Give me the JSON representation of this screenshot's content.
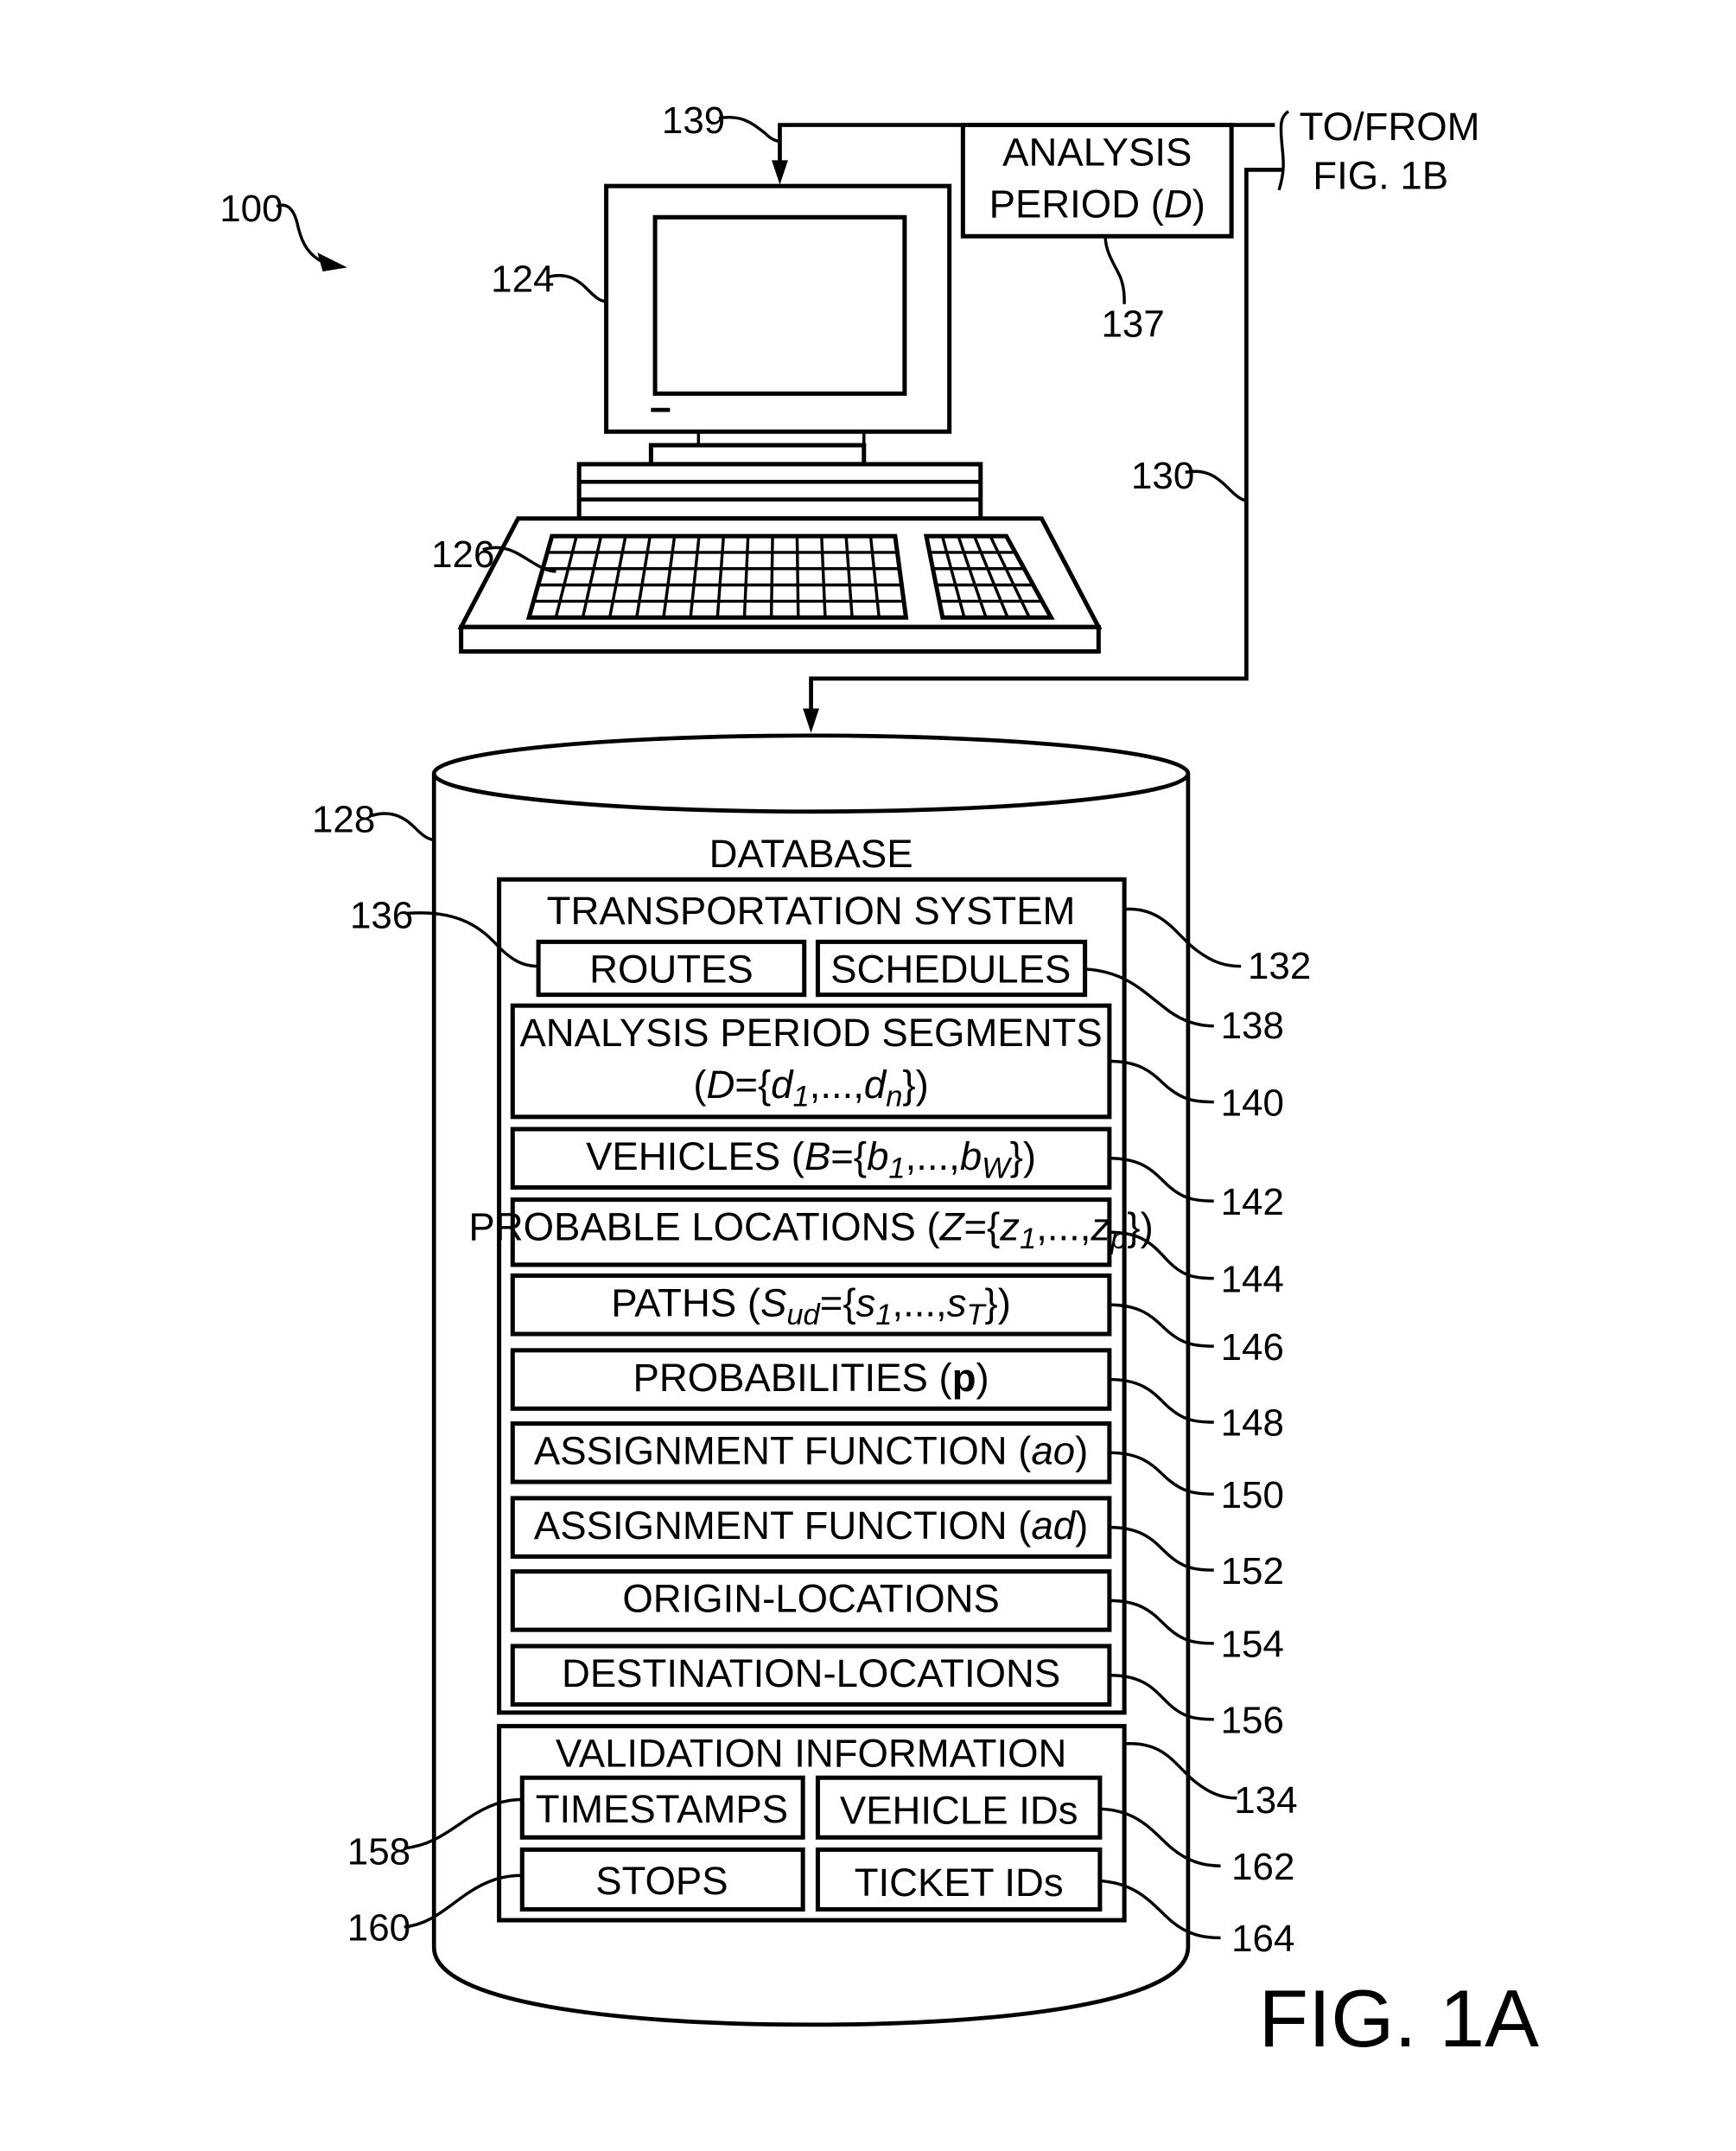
{
  "figure_label": "FIG. 1A",
  "system_ref": "100",
  "computer": {
    "monitor_ref": "124",
    "keyboard_ref": "126"
  },
  "analysis_period": {
    "ref": "137",
    "line1": "ANALYSIS",
    "line2_prefix": "PERIOD (",
    "line2_var": "D",
    "line2_suffix": ")"
  },
  "connections": {
    "input_line_ref": "139",
    "database_line_ref": "130",
    "offpage_line1": "TO/FROM",
    "offpage_line2": "FIG. 1B"
  },
  "database": {
    "ref": "128",
    "title": "DATABASE",
    "transportation_system": {
      "ref": "132",
      "title": "TRANSPORTATION SYSTEM",
      "routes": {
        "ref": "136",
        "label": "ROUTES"
      },
      "schedules": {
        "ref": "138",
        "label": "SCHEDULES"
      },
      "items": [
        {
          "ref": "140",
          "label": "ANALYSIS PERIOD SEGMENTS",
          "formula": "(D={d1,...,dn})"
        },
        {
          "ref": "142",
          "label": "VEHICLES",
          "formula": "(B={b1,...,bW})"
        },
        {
          "ref": "144",
          "label": "PROBABLE LOCATIONS",
          "formula": "(Z={z1,...,zp})"
        },
        {
          "ref": "146",
          "label": "PATHS",
          "formula": "(Sud={s1,...,sT})"
        },
        {
          "ref": "148",
          "label": "PROBABILITIES",
          "formula": "(p)"
        },
        {
          "ref": "150",
          "label": "ASSIGNMENT FUNCTION",
          "formula": "(ao)"
        },
        {
          "ref": "152",
          "label": "ASSIGNMENT FUNCTION",
          "formula": "(ad)"
        },
        {
          "ref": "154",
          "label": "ORIGIN-LOCATIONS",
          "formula": ""
        },
        {
          "ref": "156",
          "label": "DESTINATION-LOCATIONS",
          "formula": ""
        }
      ]
    },
    "validation_information": {
      "ref": "134",
      "title": "VALIDATION INFORMATION",
      "timestamps": {
        "ref": "158",
        "label": "TIMESTAMPS"
      },
      "vehicle_ids": {
        "ref": "162",
        "label": "VEHICLE IDs"
      },
      "stops": {
        "ref": "160",
        "label": "STOPS"
      },
      "ticket_ids": {
        "ref": "164",
        "label": "TICKET IDs"
      }
    }
  }
}
